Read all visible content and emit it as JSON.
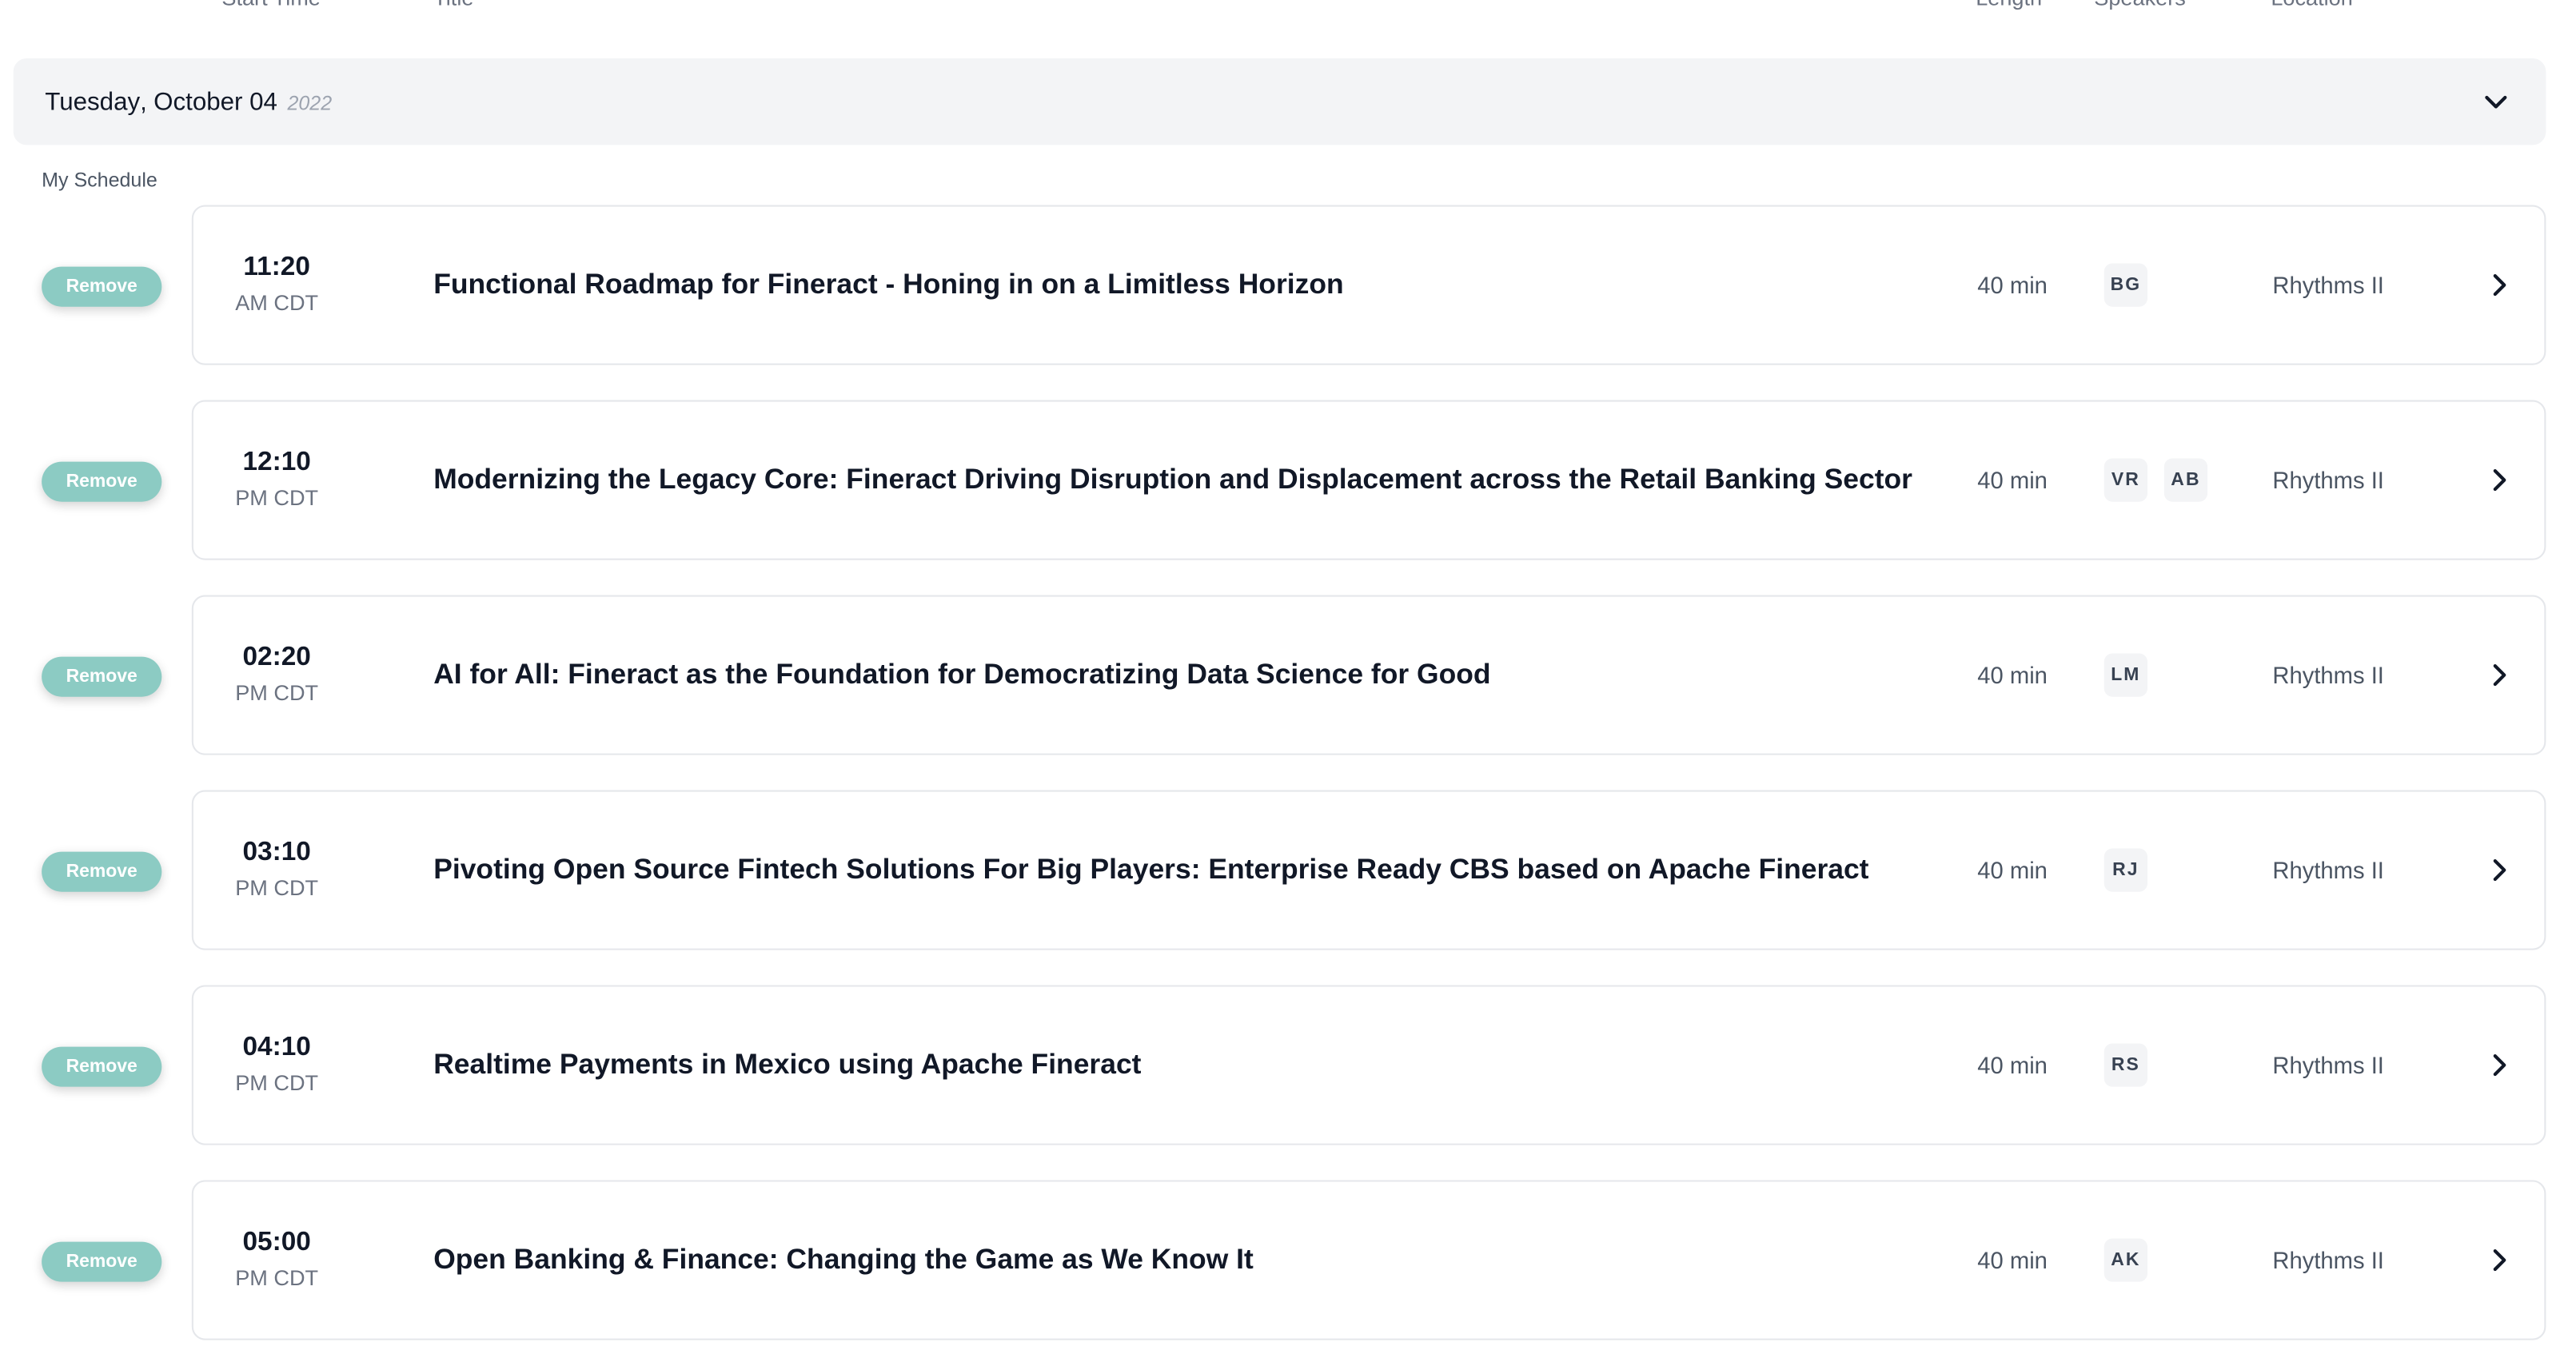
{
  "columns": {
    "start_time": "Start Time",
    "title": "Title",
    "length": "Length",
    "speakers": "Speakers",
    "location": "Location"
  },
  "date_bar": {
    "day": "Tuesday",
    "separator": ",",
    "date": "October 04",
    "year": "2022",
    "chevron_icon": "chevron-down-icon"
  },
  "section_label": "My Schedule",
  "accent_color": "#8ccbc3",
  "sessions": [
    {
      "remove_label": "Remove",
      "time": "11:20",
      "zone": "AM CDT",
      "title": "Functional Roadmap for Fineract - Honing in on a Limitless Horizon",
      "length": "40 min",
      "speakers": [
        "BG"
      ],
      "location": "Rhythms II"
    },
    {
      "remove_label": "Remove",
      "time": "12:10",
      "zone": "PM CDT",
      "title": "Modernizing the Legacy Core: Fineract Driving Disruption and Displacement across the Retail Banking Sector",
      "length": "40 min",
      "speakers": [
        "VR",
        "AB"
      ],
      "location": "Rhythms II"
    },
    {
      "remove_label": "Remove",
      "time": "02:20",
      "zone": "PM CDT",
      "title": "AI for All: Fineract as the Foundation for Democratizing Data Science for Good",
      "length": "40 min",
      "speakers": [
        "LM"
      ],
      "location": "Rhythms II"
    },
    {
      "remove_label": "Remove",
      "time": "03:10",
      "zone": "PM CDT",
      "title": "Pivoting Open Source Fintech Solutions For Big Players: Enterprise Ready CBS based on Apache Fineract",
      "length": "40 min",
      "speakers": [
        "RJ"
      ],
      "location": "Rhythms II"
    },
    {
      "remove_label": "Remove",
      "time": "04:10",
      "zone": "PM CDT",
      "title": "Realtime Payments in Mexico using Apache Fineract",
      "length": "40 min",
      "speakers": [
        "RS"
      ],
      "location": "Rhythms II"
    },
    {
      "remove_label": "Remove",
      "time": "05:00",
      "zone": "PM CDT",
      "title": "Open Banking & Finance: Changing the Game as We Know It",
      "length": "40 min",
      "speakers": [
        "AK"
      ],
      "location": "Rhythms II"
    }
  ]
}
